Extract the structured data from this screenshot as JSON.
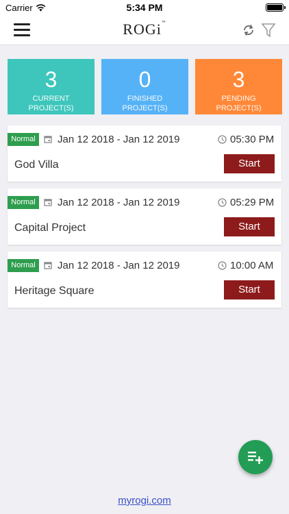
{
  "status_bar": {
    "carrier": "Carrier",
    "time": "5:34 PM"
  },
  "header": {
    "logo": "ROGi",
    "logo_tm": "™"
  },
  "stats": [
    {
      "value": "3",
      "label": "CURRENT PROJECT(S)",
      "color": "#3ec6bc"
    },
    {
      "value": "0",
      "label": "FINISHED PROJECT(S)",
      "color": "#56b2f6"
    },
    {
      "value": "3",
      "label": "PENDING PROJECT(S)",
      "color": "#ff8838"
    }
  ],
  "projects": [
    {
      "priority": "Normal",
      "date_range": "Jan 12 2018 - Jan 12 2019",
      "time": "05:30 PM",
      "name": "God Villa",
      "action": "Start"
    },
    {
      "priority": "Normal",
      "date_range": "Jan 12 2018 - Jan 12 2019",
      "time": "05:29 PM",
      "name": "Capital Project",
      "action": "Start"
    },
    {
      "priority": "Normal",
      "date_range": "Jan 12 2018 - Jan 12 2019",
      "time": "10:00 AM",
      "name": "Heritage Square",
      "action": "Start"
    }
  ],
  "footer": {
    "link": "myrogi.com"
  },
  "colors": {
    "priority_badge": "#2e9e4e",
    "start_button": "#8d1b1b",
    "fab": "#239d55"
  },
  "icons": {
    "menu": "hamburger-icon",
    "refresh": "refresh-icon",
    "filter": "filter-icon",
    "calendar": "calendar-icon",
    "clock": "clock-icon",
    "fab": "add-list-icon",
    "wifi": "wifi-icon",
    "battery": "battery-icon"
  }
}
